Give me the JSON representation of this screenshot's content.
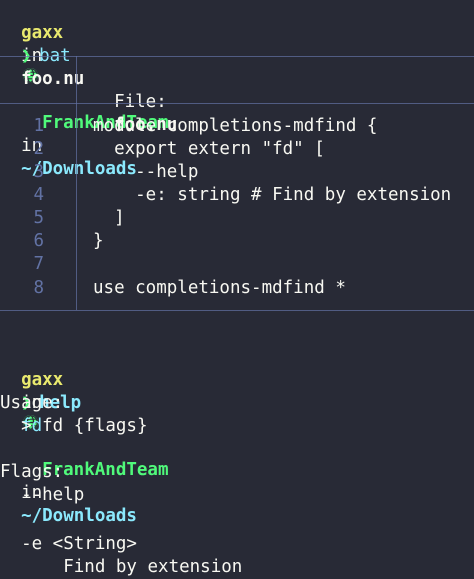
{
  "prompt1": {
    "user": "gaxx",
    "in1": "in",
    "team": "FrankAndTeam",
    "in2": "in",
    "path": "~/Downloads",
    "chevron": "❯",
    "command": "bat",
    "argument": "foo.nu"
  },
  "bat": {
    "file_label": "File:",
    "file_name": "foo.nu",
    "line_numbers": [
      "1",
      "2",
      "3",
      "4",
      "5",
      "6",
      "7",
      "8"
    ],
    "code_lines": [
      "module completions-mdfind {",
      "  export extern \"fd\" [",
      "    --help",
      "    -e: string # Find by extension",
      "  ]",
      "}",
      "",
      "use completions-mdfind *"
    ]
  },
  "prompt2": {
    "user": "gaxx",
    "in1": "in",
    "team": "FrankAndTeam",
    "in2": "in",
    "path": "~/Downloads",
    "chevron": "❯",
    "command": "help",
    "argument": "fd"
  },
  "help_output": {
    "usage_heading": "Usage:",
    "usage_line": "  > fd {flags}",
    "flags_heading": "Flags:",
    "flag1": "  --help",
    "flag2": "  -e <String>",
    "flag2_desc": "      Find by extension"
  },
  "colors": {
    "background": "#282a36",
    "user": "#e9e96e",
    "team": "#50fa7b",
    "path": "#8be9fd",
    "line_number": "#6272a4"
  },
  "icons": {
    "prompt_icon": "globe-icon",
    "prompt_chevron": "chevron-right-icon"
  }
}
